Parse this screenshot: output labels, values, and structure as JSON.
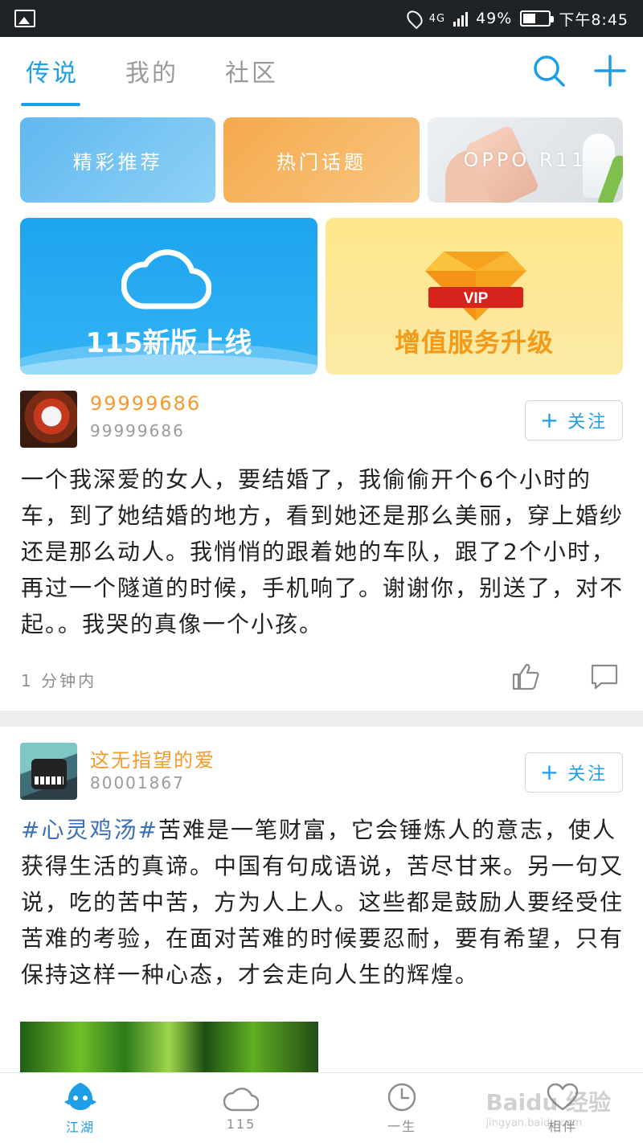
{
  "status_bar": {
    "network": "4G",
    "battery": "49%",
    "time": "下午8:45"
  },
  "tabs": [
    {
      "label": "传说",
      "active": true
    },
    {
      "label": "我的",
      "active": false
    },
    {
      "label": "社区",
      "active": false
    }
  ],
  "header_icons": [
    "search-icon",
    "plus-icon"
  ],
  "banners_small": [
    {
      "label": "精彩推荐"
    },
    {
      "label": "热门话题"
    },
    {
      "label": "OPPO R11"
    }
  ],
  "banners_big": [
    {
      "label": "115新版上线"
    },
    {
      "label": "增值服务升级",
      "badge": "VIP"
    }
  ],
  "posts": [
    {
      "username": "99999686",
      "user_id": "99999686",
      "follow_label": "关注",
      "content": "一个我深爱的女人，要结婚了，我偷偷开个6个小时的车，到了她结婚的地方，看到她还是那么美丽，穿上婚纱还是那么动人。我悄悄的跟着她的车队，跟了2个小时，再过一个隧道的时候，手机响了。谢谢你，别送了，对不起。。我哭的真像一个小孩。",
      "time": "1 分钟内"
    },
    {
      "username": "这无指望的爱",
      "user_id": "80001867",
      "follow_label": "关注",
      "hashtag": "#心灵鸡汤#",
      "content": "苦难是一笔财富，它会锤炼人的意志，使人获得生活的真谛。中国有句成语说，苦尽甘来。另一句又说，吃的苦中苦，方为人上人。这些都是鼓励人要经受住苦难的考验，在面对苦难的时候要忍耐，要有希望，只有保持这样一种心态，才会走向人生的辉煌。"
    }
  ],
  "bottom_nav": [
    {
      "label": "江湖",
      "icon": "jianghu-icon",
      "active": true
    },
    {
      "label": "115",
      "icon": "cloud-icon",
      "active": false
    },
    {
      "label": "一生",
      "icon": "clock-icon",
      "active": false
    },
    {
      "label": "相伴",
      "icon": "heart-icon",
      "active": false
    }
  ],
  "watermark": {
    "brand": "Baidu 经验",
    "url": "jingyan.baidu.com"
  },
  "colors": {
    "accent": "#1e9ee6",
    "username": "#f39a2c",
    "hashtag": "#3a70b8"
  }
}
